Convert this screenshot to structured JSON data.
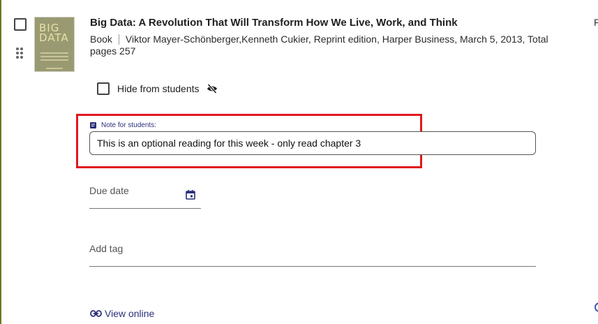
{
  "item": {
    "title": "Big Data: A Revolution That Will Transform How We Live, Work, and Think",
    "type": "Book",
    "details": "Viktor Mayer-Schönberger,Kenneth Cukier, Reprint edition, Harper Business, March 5, 2013, Total pages 257",
    "cover_text": "BIG DATA",
    "right_cut_text": "F"
  },
  "visibility": {
    "hide_label": "Hide from students",
    "checked": false
  },
  "note": {
    "label": "Note for students:",
    "value": "This is an optional reading for this week - only read chapter 3"
  },
  "due_date": {
    "label": "Due date"
  },
  "tag": {
    "label": "Add tag"
  },
  "links": {
    "view_online": "View online"
  },
  "colors": {
    "accent": "#2a2f7a",
    "highlight": "#e0191e",
    "left_rule": "#6b7a1e"
  }
}
